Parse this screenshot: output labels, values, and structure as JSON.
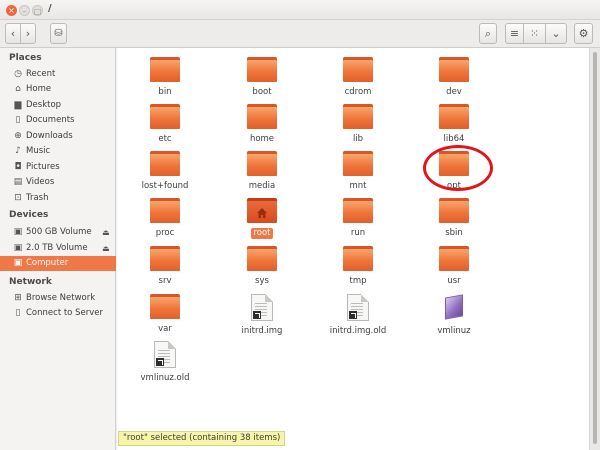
{
  "window": {
    "title": "/",
    "close_glyph": "×",
    "minimize_glyph": "–",
    "maximize_glyph": "□"
  },
  "toolbar": {
    "back_icon": "chevron-left-icon",
    "back_glyph": "‹",
    "forward_icon": "chevron-right-icon",
    "forward_glyph": "›",
    "path_icon": "disk-icon",
    "path_glyph": "⛁",
    "search_icon": "search-icon",
    "search_glyph": "⌕",
    "list_view_icon": "list-view-icon",
    "list_view_glyph": "≡",
    "grid_view_icon": "grid-view-icon",
    "grid_view_glyph": "⁙",
    "view_menu_icon": "chevron-down-icon",
    "view_menu_glyph": "⌄",
    "settings_icon": "gear-icon",
    "settings_glyph": "⚙"
  },
  "sidebar": {
    "sections": [
      {
        "heading": "Places",
        "items": [
          {
            "label": "Recent",
            "icon": "clock-icon",
            "glyph": "◷"
          },
          {
            "label": "Home",
            "icon": "home-icon",
            "glyph": "⌂"
          },
          {
            "label": "Desktop",
            "icon": "desktop-icon",
            "glyph": "▆"
          },
          {
            "label": "Documents",
            "icon": "documents-icon",
            "glyph": "▯"
          },
          {
            "label": "Downloads",
            "icon": "downloads-icon",
            "glyph": "⊕"
          },
          {
            "label": "Music",
            "icon": "music-icon",
            "glyph": "♪"
          },
          {
            "label": "Pictures",
            "icon": "pictures-icon",
            "glyph": "◘"
          },
          {
            "label": "Videos",
            "icon": "videos-icon",
            "glyph": "▤"
          },
          {
            "label": "Trash",
            "icon": "trash-icon",
            "glyph": "⊡"
          }
        ]
      },
      {
        "heading": "Devices",
        "items": [
          {
            "label": "500 GB Volume",
            "icon": "drive-icon",
            "glyph": "▣",
            "eject": "⏏"
          },
          {
            "label": "2.0 TB Volume",
            "icon": "drive-icon",
            "glyph": "▣",
            "eject": "⏏"
          },
          {
            "label": "Computer",
            "icon": "computer-icon",
            "glyph": "▣",
            "selected": true
          }
        ]
      },
      {
        "heading": "Network",
        "items": [
          {
            "label": "Browse Network",
            "icon": "network-icon",
            "glyph": "⊞"
          },
          {
            "label": "Connect to Server",
            "icon": "server-icon",
            "glyph": "▯"
          }
        ]
      }
    ]
  },
  "files": [
    {
      "name": "bin",
      "kind": "folder"
    },
    {
      "name": "boot",
      "kind": "folder"
    },
    {
      "name": "cdrom",
      "kind": "folder"
    },
    {
      "name": "dev",
      "kind": "folder"
    },
    {
      "name": "etc",
      "kind": "folder"
    },
    {
      "name": "home",
      "kind": "folder"
    },
    {
      "name": "lib",
      "kind": "folder"
    },
    {
      "name": "lib64",
      "kind": "folder"
    },
    {
      "name": "lost+found",
      "kind": "folder"
    },
    {
      "name": "media",
      "kind": "folder"
    },
    {
      "name": "mnt",
      "kind": "folder"
    },
    {
      "name": "opt",
      "kind": "folder",
      "highlighted": true
    },
    {
      "name": "proc",
      "kind": "folder"
    },
    {
      "name": "root",
      "kind": "home-folder",
      "selected": true
    },
    {
      "name": "run",
      "kind": "folder"
    },
    {
      "name": "sbin",
      "kind": "folder"
    },
    {
      "name": "srv",
      "kind": "folder"
    },
    {
      "name": "sys",
      "kind": "folder"
    },
    {
      "name": "tmp",
      "kind": "folder"
    },
    {
      "name": "usr",
      "kind": "folder"
    },
    {
      "name": "var",
      "kind": "folder"
    },
    {
      "name": "initrd.img",
      "kind": "link-document"
    },
    {
      "name": "initrd.img.old",
      "kind": "link-document"
    },
    {
      "name": "vmlinuz",
      "kind": "kernel-link"
    },
    {
      "name": "vmlinuz.old",
      "kind": "link-document"
    }
  ],
  "status": {
    "text": "\"root\" selected  (containing 38 items)"
  },
  "colors": {
    "accent": "#f07746",
    "folder": "#ef7439",
    "annotation_circle": "#e0161a",
    "status_bg": "#f6f5a8"
  }
}
